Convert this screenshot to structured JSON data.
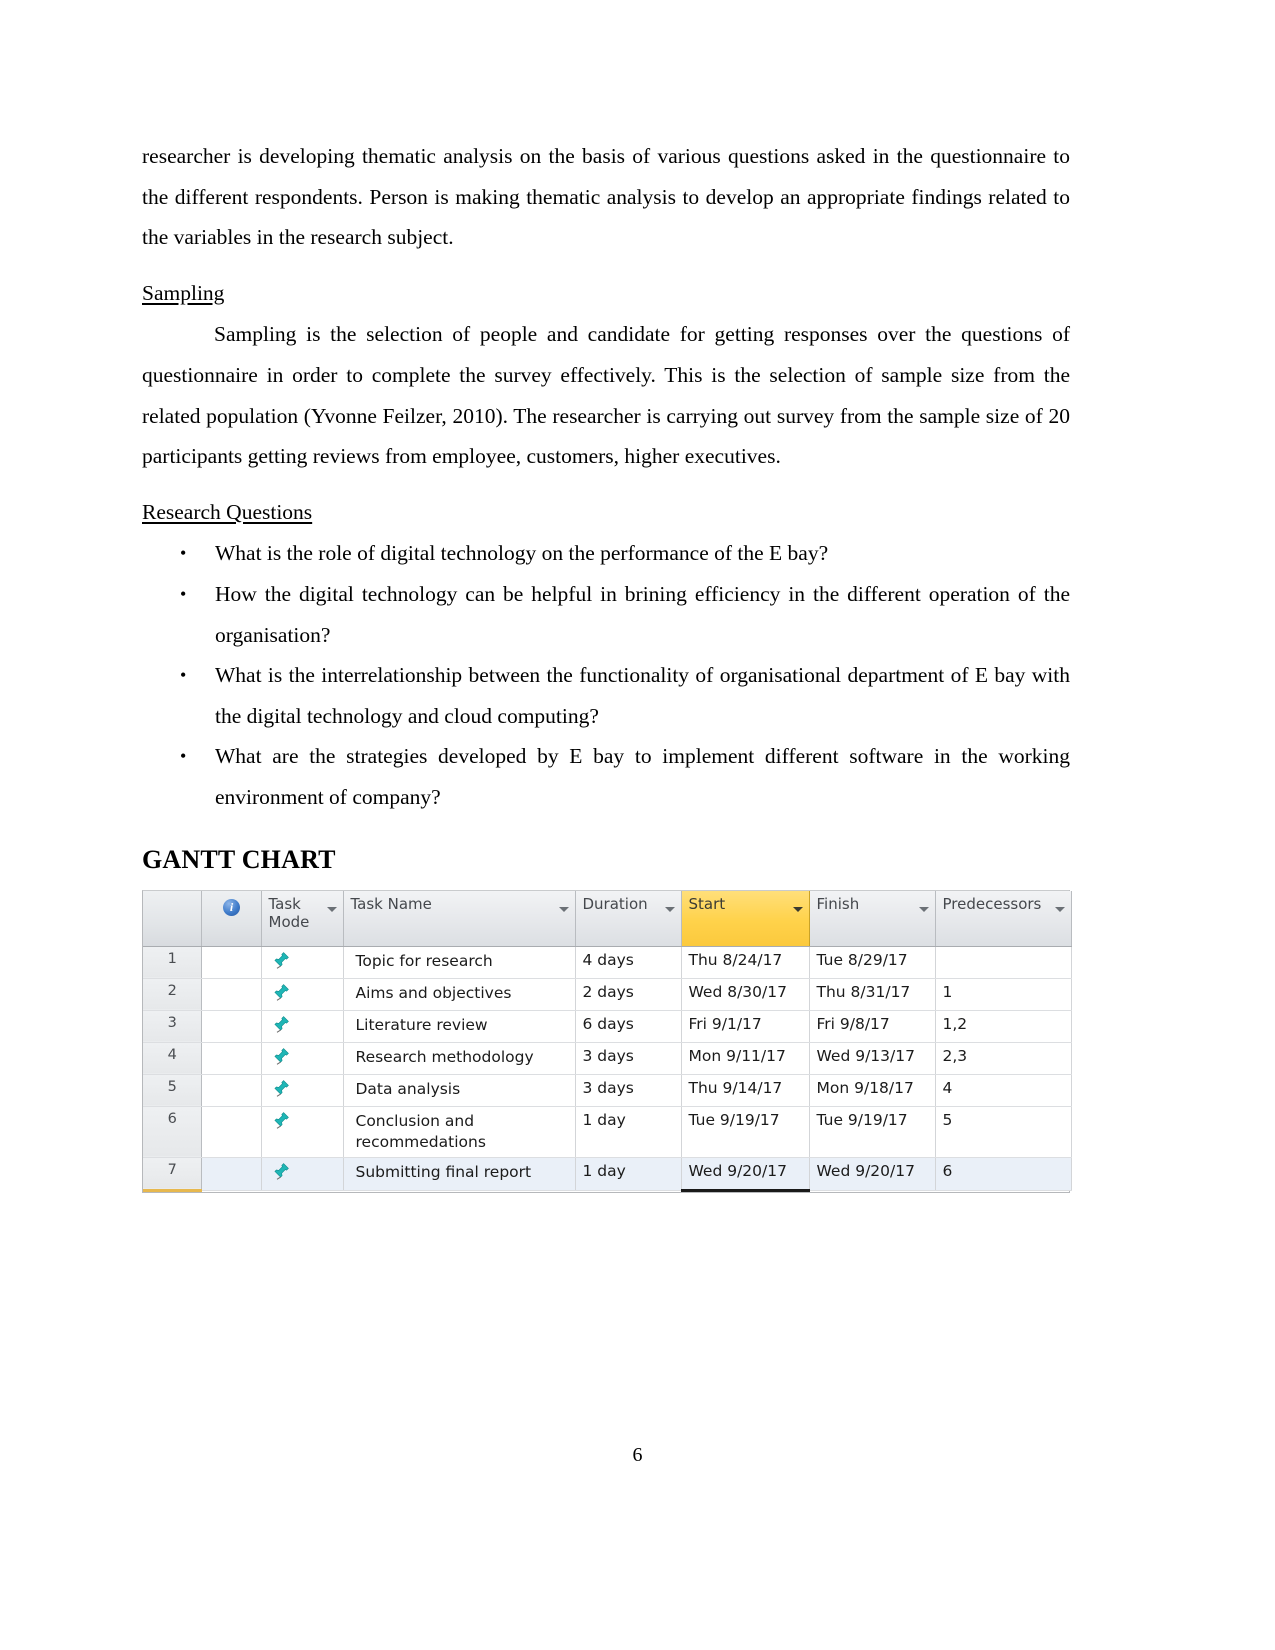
{
  "document": {
    "paragraphs": [
      "researcher is developing thematic analysis on the basis of various questions asked in the questionnaire to the different respondents. Person is making thematic analysis to develop an appropriate findings related to the variables in the research subject."
    ],
    "sampling": {
      "heading": "Sampling",
      "body": "Sampling is the selection of people and candidate for getting responses over the questions of questionnaire in order to complete the survey effectively. This is the selection of sample size from the related population (Yvonne Feilzer, 2010). The researcher is carrying out survey from the sample size of 20 participants getting reviews from employee, customers, higher executives."
    },
    "research_questions": {
      "heading": "Research Questions",
      "bullet_glyph": "•",
      "items": [
        "What is the role of digital technology on the performance of the E bay?",
        "How the digital technology can be helpful in brining efficiency in the different operation of the organisation?",
        "What is the interrelationship between the functionality of organisational department of E bay with the digital technology and cloud computing?",
        "What are the strategies developed by E bay to implement different software in the working environment of company?"
      ]
    },
    "gantt": {
      "title": "GANTT CHART",
      "accent_highlight_color": "#ffd24a",
      "pin_color": "#1fb6b6",
      "selected_row_color": "#eaf0f8",
      "columns": [
        {
          "key": "id",
          "label": "",
          "has_filter_arrow": false
        },
        {
          "key": "indicators",
          "label": "",
          "icon": "info-icon",
          "has_filter_arrow": false
        },
        {
          "key": "mode",
          "label": "Task Mode",
          "has_filter_arrow": true
        },
        {
          "key": "name",
          "label": "Task Name",
          "has_filter_arrow": true
        },
        {
          "key": "duration",
          "label": "Duration",
          "has_filter_arrow": true
        },
        {
          "key": "start",
          "label": "Start",
          "has_filter_arrow": true,
          "highlighted": true
        },
        {
          "key": "finish",
          "label": "Finish",
          "has_filter_arrow": true
        },
        {
          "key": "predecessors",
          "label": "Predecessors",
          "has_filter_arrow": true
        }
      ],
      "rows": [
        {
          "id": "1",
          "mode_icon": "pushpin-icon",
          "name": "Topic for research",
          "duration": "4 days",
          "start": "Thu 8/24/17",
          "finish": "Tue 8/29/17",
          "predecessors": "",
          "selected": false
        },
        {
          "id": "2",
          "mode_icon": "pushpin-icon",
          "name": "Aims and objectives",
          "duration": "2 days",
          "start": "Wed 8/30/17",
          "finish": "Thu 8/31/17",
          "predecessors": "1",
          "selected": false
        },
        {
          "id": "3",
          "mode_icon": "pushpin-icon",
          "name": "Literature review",
          "duration": "6 days",
          "start": "Fri 9/1/17",
          "finish": "Fri 9/8/17",
          "predecessors": "1,2",
          "selected": false
        },
        {
          "id": "4",
          "mode_icon": "pushpin-icon",
          "name": "Research methodology",
          "duration": "3 days",
          "start": "Mon 9/11/17",
          "finish": "Wed 9/13/17",
          "predecessors": "2,3",
          "selected": false
        },
        {
          "id": "5",
          "mode_icon": "pushpin-icon",
          "name": "Data analysis",
          "duration": "3 days",
          "start": "Thu 9/14/17",
          "finish": "Mon 9/18/17",
          "predecessors": "4",
          "selected": false
        },
        {
          "id": "6",
          "mode_icon": "pushpin-icon",
          "name": "Conclusion and recommedations",
          "duration": "1 day",
          "start": "Tue 9/19/17",
          "finish": "Tue 9/19/17",
          "predecessors": "5",
          "selected": false
        },
        {
          "id": "7",
          "mode_icon": "pushpin-icon",
          "name": "Submitting final report",
          "duration": "1 day",
          "start": "Wed 9/20/17",
          "finish": "Wed 9/20/17",
          "predecessors": "6",
          "selected": true
        }
      ]
    },
    "page_number": "6"
  }
}
